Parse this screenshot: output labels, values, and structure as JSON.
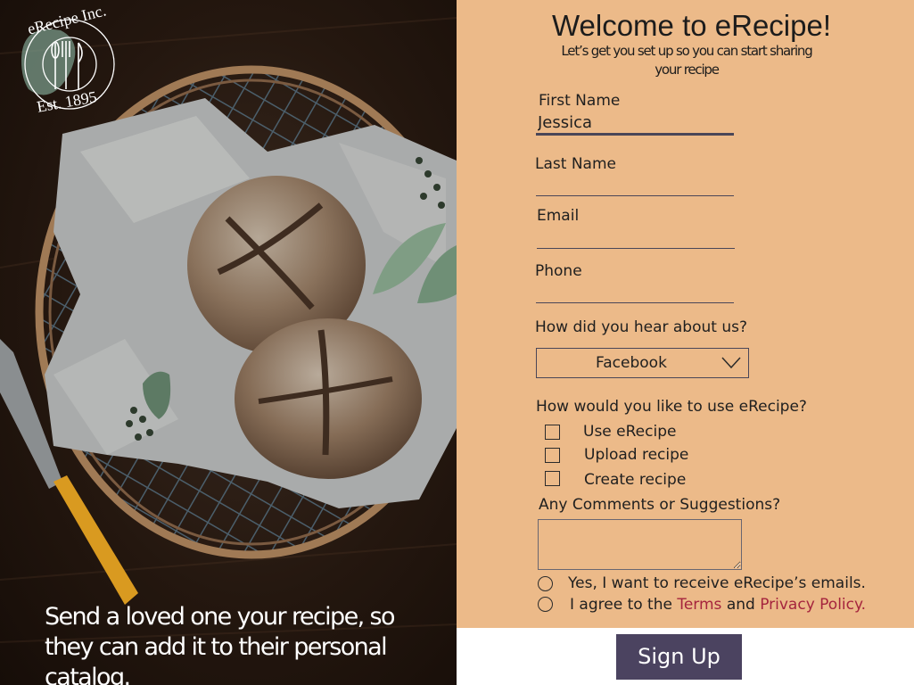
{
  "logo": {
    "top_text": "eRecipe Inc.",
    "bottom_text": "Est. 1895",
    "icon": "cutlery-icon"
  },
  "hero": {
    "tagline": "Send a loved one your recipe, so they can add it to their personal catalog."
  },
  "form": {
    "title": "Welcome to eRecipe!",
    "subtitle": "Let’s get you set up so you can start sharing your recipe",
    "first_name": {
      "label": "First Name",
      "value": "Jessica"
    },
    "last_name": {
      "label": "Last Name",
      "value": ""
    },
    "email": {
      "label": "Email",
      "value": ""
    },
    "phone": {
      "label": "Phone",
      "value": ""
    },
    "referral": {
      "label": "How did you hear about us?",
      "selected": "Facebook",
      "icon": "chevron-down-icon"
    },
    "usage": {
      "label": "How would you like to use eRecipe?",
      "options": [
        "Use eRecipe",
        "Upload recipe",
        "Create recipe"
      ]
    },
    "comments": {
      "label": "Any Comments or Suggestions?",
      "value": ""
    },
    "consent": {
      "emails": "Yes, I want to receive eRecipe’s emails.",
      "agree_prefix": "I agree to the",
      "terms": "Terms",
      "and": "and",
      "privacy": "Privacy Policy."
    },
    "submit_label": "Sign Up"
  },
  "colors": {
    "panel": "#ecba89",
    "button": "#4b4360",
    "link": "#a5243d",
    "text": "#1f1f1f"
  }
}
